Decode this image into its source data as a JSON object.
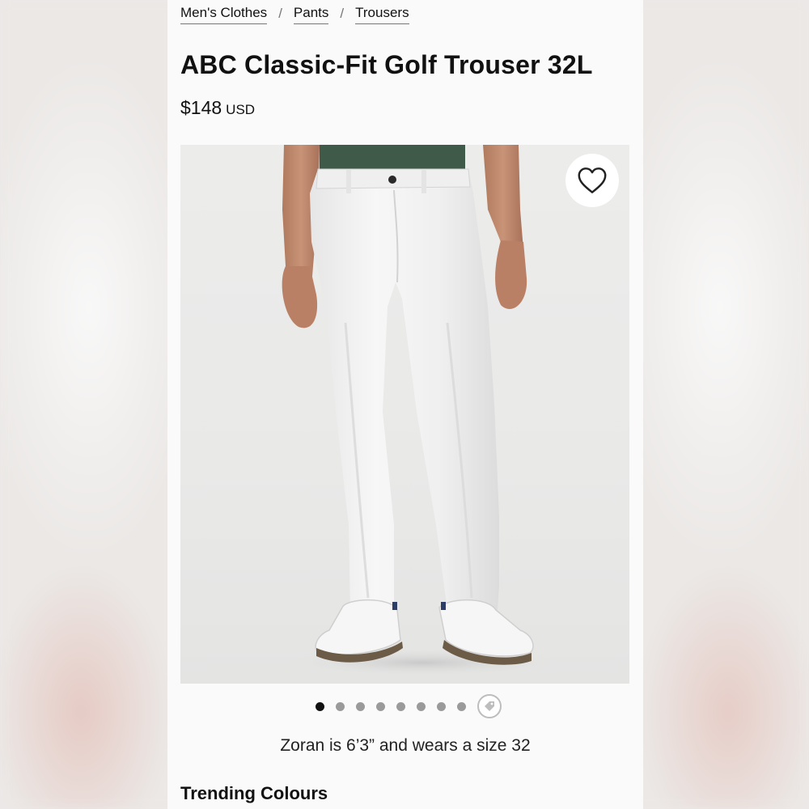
{
  "breadcrumb": [
    {
      "label": "Men's Clothes"
    },
    {
      "label": "Pants"
    },
    {
      "label": "Trousers"
    }
  ],
  "breadcrumb_separator": "/",
  "product": {
    "title": "ABC Classic-Fit Golf Trouser 32L",
    "price": "$148",
    "currency": "USD",
    "image_alt_icon": "product-photo",
    "favorite_icon": "heart-icon"
  },
  "gallery": {
    "total_images": 8,
    "active_index": 0,
    "extra_icon": "tag-icon"
  },
  "model_note": "Zoran is 6’3” and wears a size 32",
  "sections": {
    "trending_colours": "Trending Colours"
  },
  "colors": {
    "text": "#111111",
    "background": "#fafafa",
    "shirt": "#3f5a48",
    "trousers": "#f3f3f3"
  }
}
